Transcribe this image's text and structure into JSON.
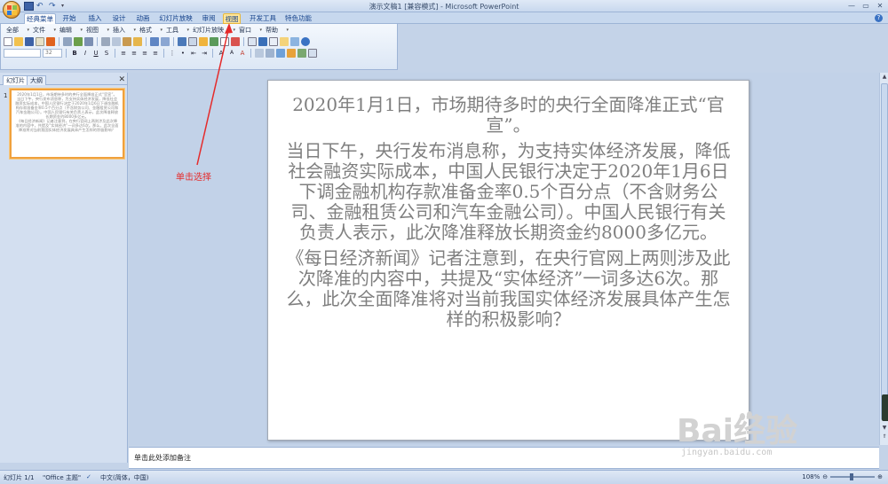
{
  "window": {
    "title": "演示文稿1 [兼容模式] - Microsoft PowerPoint"
  },
  "ribbon": {
    "tabs": [
      "经典菜单",
      "开始",
      "插入",
      "设计",
      "动画",
      "幻灯片放映",
      "审阅",
      "视图",
      "开发工具",
      "特色功能"
    ],
    "active_tab": "经典菜单",
    "highlighted_tab": "视图"
  },
  "classic_menu": {
    "items": [
      "全部",
      "文件",
      "编辑",
      "视图",
      "插入",
      "格式",
      "工具",
      "幻灯片放映",
      "窗口",
      "帮助"
    ],
    "font_size_value": "32"
  },
  "left_panel": {
    "tabs": [
      "幻灯片",
      "大纲"
    ],
    "slide_number": "1"
  },
  "slide": {
    "paragraphs": [
      "2020年1月1日，市场期待多时的央行全面降准正式“官宣”。",
      "当日下午，央行发布消息称，为支持实体经济发展，降低社会融资实际成本，中国人民银行决定于2020年1月6日下调金融机构存款准备金率0.5个百分点（不含财务公司、金融租赁公司和汽车金融公司）。中国人民银行有关负责人表示，此次降准释放长期资金约8000多亿元。",
      "《每日经济新闻》记者注意到，在央行官网上两则涉及此次降准的内容中，共提及“实体经济”一词多达6次。那么，此次全面降准将对当前我国实体经济发展具体产生怎样的积极影响？"
    ]
  },
  "notes": {
    "placeholder": "单击此处添加备注"
  },
  "status_bar": {
    "slide_info": "幻灯片 1/1",
    "theme": "\"Office 主题\"",
    "language": "中文(简体，中国)",
    "zoom": "108%"
  },
  "annotation": {
    "label": "单击选择"
  },
  "watermark": {
    "brand": "Bai经验",
    "url": "jingyan.baidu.com"
  },
  "colors": {
    "accent": "#f0a13d",
    "annotation": "#e52b2b",
    "slide_text": "#7f7f7f"
  }
}
